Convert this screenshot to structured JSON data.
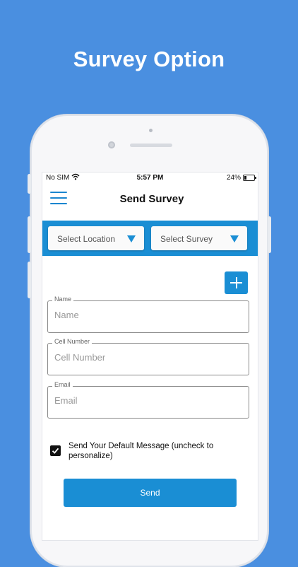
{
  "headline": "Survey Option",
  "status_bar": {
    "carrier": "No SIM",
    "time": "5:57 PM",
    "battery": "24%"
  },
  "navbar": {
    "title": "Send Survey",
    "menu_icon": "hamburger-icon"
  },
  "filters": {
    "location": {
      "label": "Select Location",
      "icon": "triangle-down-icon"
    },
    "survey": {
      "label": "Select Survey",
      "icon": "triangle-down-icon"
    }
  },
  "add_button": {
    "icon": "plus-icon"
  },
  "form": {
    "name": {
      "label": "Name",
      "placeholder": "Name"
    },
    "cell": {
      "label": "Cell Number",
      "placeholder": "Cell Number"
    },
    "email": {
      "label": "Email",
      "placeholder": "Email"
    }
  },
  "default_message": {
    "label": "Send Your Default Message (uncheck to personalize)",
    "checked": true
  },
  "send_button": {
    "label": "Send"
  },
  "colors": {
    "background": "#4a8fe0",
    "accent": "#1a8ed4"
  }
}
